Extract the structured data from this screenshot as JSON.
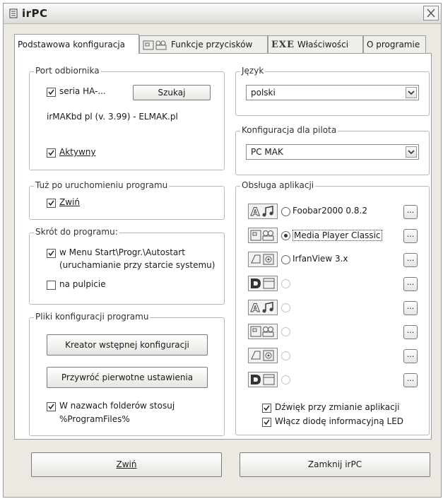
{
  "window": {
    "title": "irPC"
  },
  "tabs": [
    {
      "label": "Podstawowa konfiguracja"
    },
    {
      "label": "Funkcje przycisków",
      "icon": "buttons-icon"
    },
    {
      "label": "Właściwości",
      "prefix": "EXE"
    },
    {
      "label": "O programie"
    }
  ],
  "port": {
    "title": "Port odbiornika",
    "series_label": "seria HA-...",
    "series_checked": true,
    "search_button": "Szukaj",
    "device_info": "irMAKbd pl  (v. 3.99)  -  ELMAK.pl",
    "active_label": "Aktywny",
    "active_checked": true
  },
  "startup": {
    "title": "Tuż po uruchomieniu programu",
    "minimize_label": "Zwiń",
    "minimize_checked": true
  },
  "shortcut": {
    "title": "Skrót do programu:",
    "menu_label_line1": "w Menu Start\\Progr.\\Autostart",
    "menu_label_line2": "(uruchamianie przy starcie systemu)",
    "menu_checked": true,
    "desktop_label": "na pulpicie",
    "desktop_checked": false
  },
  "config_files": {
    "title": "Pliki konfiguracji programu",
    "wizard_button": "Kreator wstępnej konfiguracji",
    "restore_button": "Przywróć pierwotne ustawienia",
    "folders_label_line1": "W nazwach folderów stosuj",
    "folders_label_line2": "%ProgramFiles%",
    "folders_checked": true
  },
  "language": {
    "title": "Język",
    "value": "polski"
  },
  "remote": {
    "title": "Konfiguracja dla pilota",
    "value": "PC MAK"
  },
  "apps": {
    "title": "Obsługa aplikacji",
    "items": [
      {
        "label": "Foobar2000 0.8.2",
        "icon": "audio-icon",
        "selected": false,
        "enabled": true
      },
      {
        "label": "Media Player Classic",
        "icon": "video-icon",
        "selected": true,
        "enabled": true
      },
      {
        "label": "IrfanView 3.x",
        "icon": "image-icon",
        "selected": false,
        "enabled": true
      },
      {
        "label": "",
        "icon": "dvd-icon",
        "selected": false,
        "enabled": false
      },
      {
        "label": "",
        "icon": "audio-icon",
        "selected": false,
        "enabled": false
      },
      {
        "label": "",
        "icon": "video-icon",
        "selected": false,
        "enabled": false
      },
      {
        "label": "",
        "icon": "image-icon",
        "selected": false,
        "enabled": false
      },
      {
        "label": "",
        "icon": "dvd-icon",
        "selected": false,
        "enabled": false
      }
    ],
    "browse_label": "...",
    "sound_label": "Dźwięk przy zmianie aplikacji",
    "sound_checked": true,
    "led_label": "Włącz diodę informacyjną LED",
    "led_checked": true
  },
  "footer": {
    "minimize_button": "Zwiń",
    "close_button": "Zamknij irPC"
  }
}
